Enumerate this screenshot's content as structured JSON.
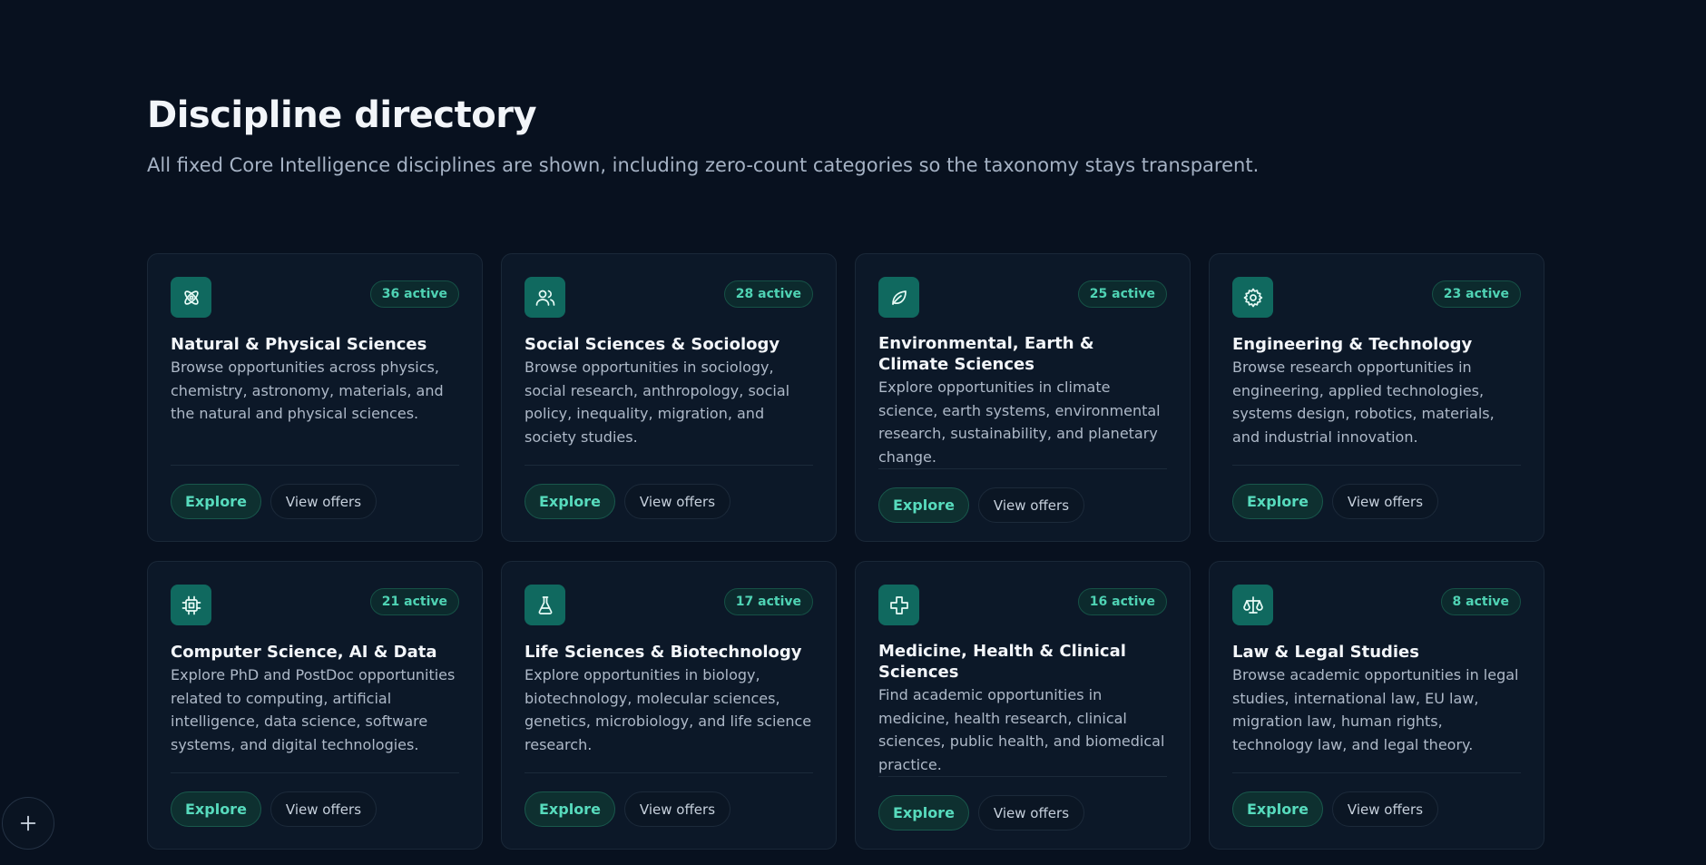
{
  "header": {
    "title": "Discipline directory",
    "subtitle": "All fixed Core Intelligence disciplines are shown, including zero-count categories so the taxonomy stays transparent."
  },
  "colors": {
    "background": "#08111f",
    "card": "#0c1828",
    "accent": "#4fd3b4",
    "icon_tile": "#10695f"
  },
  "actions": {
    "explore_label": "Explore",
    "offers_label": "View offers"
  },
  "cards": [
    {
      "icon": "atom-icon",
      "badge": "36 active",
      "title": "Natural & Physical Sciences",
      "description": "Browse opportunities across physics, chemistry, astronomy, materials, and the natural and physical sciences."
    },
    {
      "icon": "users-icon",
      "badge": "28 active",
      "title": "Social Sciences & Sociology",
      "description": "Browse opportunities in sociology, social research, anthropology, social policy, inequality, migration, and society studies."
    },
    {
      "icon": "leaf-icon",
      "badge": "25 active",
      "title": "Environmental, Earth & Climate Sciences",
      "description": "Explore opportunities in climate science, earth systems, environmental research, sustainability, and planetary change."
    },
    {
      "icon": "gear-icon",
      "badge": "23 active",
      "title": "Engineering & Technology",
      "description": "Browse research opportunities in engineering, applied technologies, systems design, robotics, materials, and industrial innovation."
    },
    {
      "icon": "cpu-icon",
      "badge": "21 active",
      "title": "Computer Science, AI & Data",
      "description": "Explore PhD and PostDoc opportunities related to computing, artificial intelligence, data science, software systems, and digital technologies."
    },
    {
      "icon": "flask-icon",
      "badge": "17 active",
      "title": "Life Sciences & Biotechnology",
      "description": "Explore opportunities in biology, biotechnology, molecular sciences, genetics, microbiology, and life science research."
    },
    {
      "icon": "medical-cross-icon",
      "badge": "16 active",
      "title": "Medicine, Health & Clinical Sciences",
      "description": "Find academic opportunities in medicine, health research, clinical sciences, public health, and biomedical practice."
    },
    {
      "icon": "scales-icon",
      "badge": "8 active",
      "title": "Law & Legal Studies",
      "description": "Browse academic opportunities in legal studies, international law, EU law, migration law, human rights, technology law, and legal theory."
    }
  ],
  "fab": {
    "icon": "plus-icon"
  }
}
